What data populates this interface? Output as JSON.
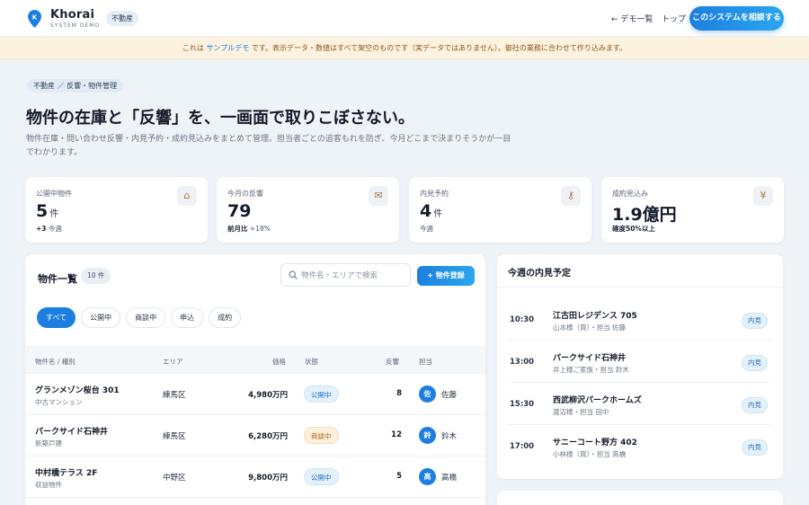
{
  "header": {
    "brand": "Khorai",
    "brand_sub": "SYSTEM DEMO",
    "category": "不動産",
    "nav_demo": "← デモ一覧",
    "nav_top": "トップ",
    "cta": "このシステムを相談する"
  },
  "banner": {
    "pre": "これは ",
    "highlight": "サンプルデモ",
    "post": " です。表示データ・数値はすべて架空のものです（実データではありません）。御社の業務に合わせて作り込みます。"
  },
  "breadcrumb": "不動産 ／ 反響・物件管理",
  "title": "物件の在庫と「反響」を、一画面で取りこぼさない。",
  "description": "物件在庫・問い合わせ反響・内見予約・成約見込みをまとめて管理。担当者ごとの追客もれを防ぎ、今月どこまで決まりそうかが一目でわかります。",
  "stats": [
    {
      "label": "公開中物件",
      "value": "5",
      "unit": "件",
      "sub_pre": "+3",
      "sub_post": " 今週",
      "icon": "house-icon",
      "glyph": "⌂"
    },
    {
      "label": "今月の反響",
      "value": "79",
      "unit": "",
      "sub_pre": "前月比",
      "sub_post": " +18%",
      "icon": "mail-icon",
      "glyph": "✉"
    },
    {
      "label": "内見予約",
      "value": "4",
      "unit": "件",
      "sub_pre": "今週",
      "sub_post": "",
      "icon": "key-icon",
      "glyph": "⚷"
    },
    {
      "label": "成約見込み",
      "value": "1.9億円",
      "unit": "",
      "sub_pre": "確度50%以上",
      "sub_post": "",
      "icon": "money-bag-icon",
      "glyph": "¥"
    }
  ],
  "properties": {
    "title": "物件一覧",
    "count": "10 件",
    "search_placeholder": "物件名・エリアで検索",
    "add_label": "+ 物件登録",
    "filters": [
      "すべて",
      "公開中",
      "商談中",
      "申込",
      "成約"
    ],
    "columns": {
      "name": "物件名 / 種別",
      "area": "エリア",
      "price": "価格",
      "status": "状態",
      "responses": "反響",
      "assignee": "担当"
    },
    "rows": [
      {
        "name": "グランメゾン桜台 301",
        "type": "中古マンション",
        "area": "練馬区",
        "price": "4,980万円",
        "status": "公開中",
        "responses": "8",
        "initial": "佐",
        "assignee": "佐藤"
      },
      {
        "name": "パークサイド石神井",
        "type": "新築戸建",
        "area": "練馬区",
        "price": "6,280万円",
        "status": "商談中",
        "responses": "12",
        "initial": "鈴",
        "assignee": "鈴木"
      },
      {
        "name": "中村橋テラス 2F",
        "type": "収益物件",
        "area": "中野区",
        "price": "9,800万円",
        "status": "公開中",
        "responses": "5",
        "initial": "高",
        "assignee": "高橋"
      }
    ]
  },
  "schedule": {
    "title": "今週の内見予定",
    "items": [
      {
        "time": "10:30",
        "name": "江古田レジデンス 705",
        "sub": "山本様（買）・担当 佐藤",
        "tag": "内見"
      },
      {
        "time": "13:00",
        "name": "パークサイド石神井",
        "sub": "井上様ご家族・担当 鈴木",
        "tag": "内見"
      },
      {
        "time": "15:30",
        "name": "西武柳沢パークホームズ",
        "sub": "渡辺様・担当 田中",
        "tag": "内見"
      },
      {
        "time": "17:00",
        "name": "サニーコート野方 402",
        "sub": "小林様（買）・担当 高橋",
        "tag": "内見"
      }
    ]
  },
  "colors": {
    "accent": "#1c7fe0",
    "status_open": "#1c6fbf",
    "status_negotiating": "#b0651a",
    "banner_bg": "#fdf1df"
  }
}
